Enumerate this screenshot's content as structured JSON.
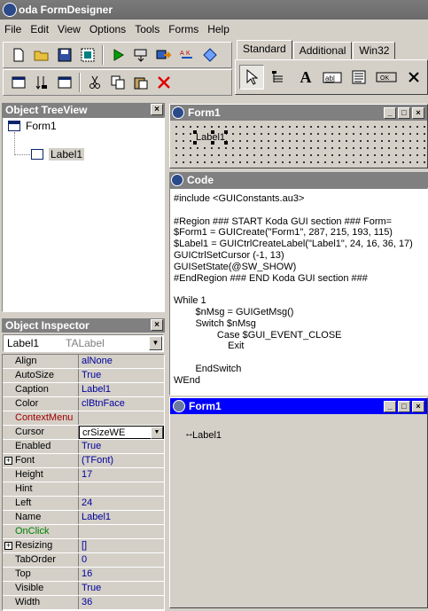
{
  "app": {
    "title": "oda FormDesigner"
  },
  "menu": [
    "File",
    "Edit",
    "View",
    "Options",
    "Tools",
    "Forms",
    "Help"
  ],
  "toolbar1": [
    "new-file-icon",
    "open-folder-icon",
    "save-icon",
    "form-icon",
    "run-icon",
    "compile-icon",
    "export-icon",
    "spell-icon",
    "diamond-icon"
  ],
  "toolbar2": [
    "window-icon",
    "tab-order-icon",
    "window2-icon",
    "cut-icon",
    "copy-icon",
    "paste-icon",
    "delete-icon"
  ],
  "palette": {
    "tabs": [
      "Standard",
      "Additional",
      "Win32"
    ],
    "tools": [
      "pointer-icon",
      "menu-tool-icon",
      "label-tool-icon",
      "input-tool-icon",
      "edit-tool-icon",
      "button-tool-icon",
      "close-tool-icon"
    ]
  },
  "treeview": {
    "title": "Object TreeView",
    "root": "Form1",
    "child": "Label1"
  },
  "inspector": {
    "title": "Object Inspector",
    "selector": {
      "name": "Label1",
      "type": "TALabel"
    },
    "rows": [
      {
        "name": "Align",
        "value": "alNone",
        "color": "#000000"
      },
      {
        "name": "AutoSize",
        "value": "True",
        "color": "#000000"
      },
      {
        "name": "Caption",
        "value": "Label1",
        "color": "#000000"
      },
      {
        "name": "Color",
        "value": "clBtnFace",
        "color": "#000000"
      },
      {
        "name": "ContextMenu",
        "value": "",
        "color": "#a00000"
      },
      {
        "name": "Cursor",
        "value": "crSizeWE",
        "color": "#000000",
        "edit": true
      },
      {
        "name": "Enabled",
        "value": "True",
        "color": "#000000"
      },
      {
        "name": "Font",
        "value": "(TFont)",
        "color": "#000000",
        "plus": true
      },
      {
        "name": "Height",
        "value": "17",
        "color": "#000000"
      },
      {
        "name": "Hint",
        "value": "",
        "color": "#000000"
      },
      {
        "name": "Left",
        "value": "24",
        "color": "#000000"
      },
      {
        "name": "Name",
        "value": "Label1",
        "color": "#000000"
      },
      {
        "name": "OnClick",
        "value": "",
        "color": "#008000"
      },
      {
        "name": "Resizing",
        "value": "[]",
        "color": "#000000",
        "plus": true
      },
      {
        "name": "TabOrder",
        "value": "0",
        "color": "#000000"
      },
      {
        "name": "Top",
        "value": "16",
        "color": "#000000"
      },
      {
        "name": "Visible",
        "value": "True",
        "color": "#000000"
      },
      {
        "name": "Width",
        "value": "36",
        "color": "#000000"
      }
    ]
  },
  "form1": {
    "title": "Form1",
    "label": "Label1"
  },
  "code": {
    "title": "Code",
    "lines": [
      "#include <GUIConstants.au3>",
      "",
      "#Region ### START Koda GUI section ### Form=",
      "$Form1 = GUICreate(\"Form1\", 287, 215, 193, 115)",
      "$Label1 = GUICtrlCreateLabel(\"Label1\", 24, 16, 36, 17)",
      "GUICtrlSetCursor (-1, 13)",
      "GUISetState(@SW_SHOW)",
      "#EndRegion ### END Koda GUI section ###",
      "",
      "While 1",
      "\t\t$nMsg = GUIGetMsg()",
      "\t\tSwitch $nMsg",
      "\t\t\t\tCase $GUI_EVENT_CLOSE",
      "\t\t\t\t\tExit",
      "",
      "\t\tEndSwitch",
      "WEnd"
    ]
  },
  "preview": {
    "title": "Form1",
    "label": "Label1"
  }
}
